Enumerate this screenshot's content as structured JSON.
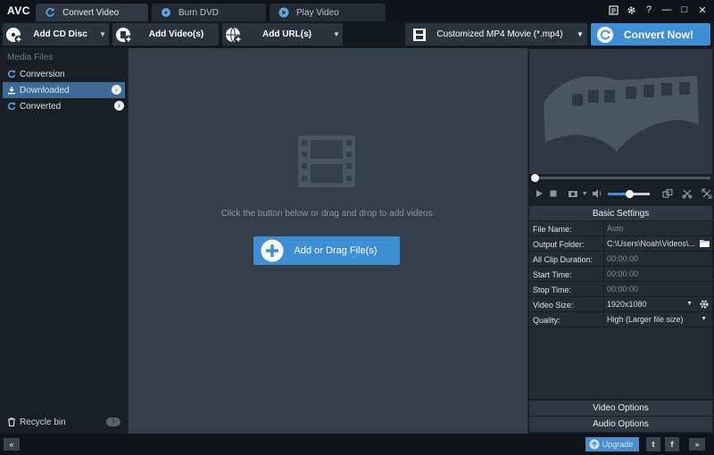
{
  "app": {
    "logo": "AVC"
  },
  "tabs": [
    {
      "label": "Convert Video"
    },
    {
      "label": "Burn DVD"
    },
    {
      "label": "Play Video"
    }
  ],
  "window_controls": {
    "minimize": "—",
    "maximize": "□",
    "close": "✕",
    "help": "?"
  },
  "toolbar": {
    "add_cd": "Add CD Disc",
    "add_videos": "Add Video(s)",
    "add_url": "Add URL(s)",
    "profile": "Customized MP4 Movie (*.mp4)",
    "convert": "Convert Now!"
  },
  "sidebar": {
    "header": "Media Files",
    "items": [
      {
        "label": "Conversion"
      },
      {
        "label": "Downloaded"
      },
      {
        "label": "Converted"
      }
    ],
    "recycle": "Recycle bin",
    "recycle_count": "1"
  },
  "main": {
    "hint": "Click the button below or drag and drop to add videos.",
    "add_button": "Add or Drag File(s)"
  },
  "settings": {
    "title": "Basic Settings",
    "rows": [
      {
        "key": "File Name:",
        "value": "Auto"
      },
      {
        "key": "Output Folder:",
        "value": "C:\\Users\\Noah\\Videos\\..."
      },
      {
        "key": "All Clip Duration:",
        "value": "00:00:00"
      },
      {
        "key": "Start Time:",
        "value": "00:00:00"
      },
      {
        "key": "Stop Time:",
        "value": "00:00:00"
      },
      {
        "key": "Video Size:",
        "value": "1920x1080"
      },
      {
        "key": "Quality:",
        "value": "High (Larger file size)"
      }
    ],
    "video_options": "Video Options",
    "audio_options": "Audio Options"
  },
  "player": {
    "volume_fraction": 0.5,
    "seek_fraction": 0.0
  },
  "statusbar": {
    "collapse": "«",
    "upgrade": "Upgrade",
    "twitter": "t",
    "facebook": "f",
    "expand": "»"
  },
  "colors": {
    "accent": "#3d8fd6",
    "active_item": "#3d6a96"
  }
}
